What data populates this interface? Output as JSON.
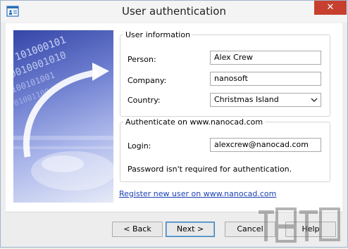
{
  "window": {
    "title": "User authentication",
    "close_glyph": "✕"
  },
  "user_info": {
    "legend": "User information",
    "person_label": "Person:",
    "person_value": "Alex Crew",
    "company_label": "Company:",
    "company_value": "nanosoft",
    "country_label": "Country:",
    "country_value": "Christmas Island"
  },
  "auth": {
    "legend": "Authenticate on www.nanocad.com",
    "login_label": "Login:",
    "login_value": "alexcrew@nanocad.com",
    "note": "Password isn't required for authentication."
  },
  "register_link": "Register new user on www.nanocad.com",
  "buttons": {
    "back": "< Back",
    "next": "Next >",
    "cancel": "Cancel",
    "help": "Help"
  },
  "picture": {
    "digits": [
      "101000101",
      "0010001010",
      "100101001",
      "01001100"
    ]
  },
  "icons": {
    "app": "app-window-icon",
    "close": "close-icon",
    "dropdown": "chevron-down-icon",
    "watermark": "watermark-logo"
  },
  "colors": {
    "close": "#c7402f",
    "link": "#1a3fb5",
    "picture": "#3545a8"
  }
}
